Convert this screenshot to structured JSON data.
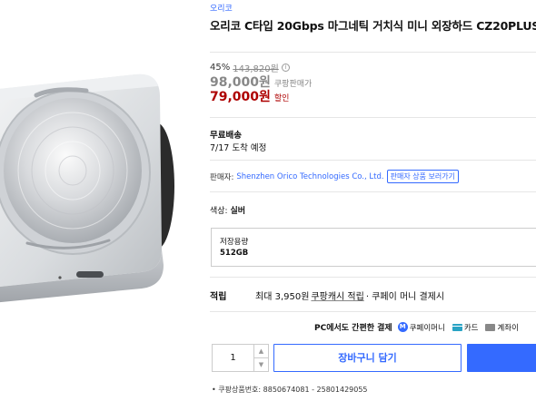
{
  "product": {
    "brand": "오리코",
    "title": "오리코 C타입 20Gbps 마그네틱 거치식 미니 외장하드 CZ20PLUS"
  },
  "pricing": {
    "discount_rate": "45%",
    "original_price": "143,820원",
    "info_icon": "info-icon",
    "coupang_price": "98,000원",
    "coupang_price_label": "쿠팡판매가",
    "sale_price": "79,000원",
    "sale_price_label": "할인",
    "sale_color": "#ae0000"
  },
  "shipping": {
    "title": "무료배송",
    "date": "7/17 도착 예정"
  },
  "seller": {
    "label": "판매자:",
    "name": "Shenzhen Orico Technologies Co., Ltd.",
    "link": "판매자 상품 보러가기"
  },
  "options": {
    "color_label": "색상:",
    "color_value": "실버",
    "storage_label": "저장용량",
    "storage_value": "512GB"
  },
  "reward": {
    "label": "적립",
    "prefix": "최대 3,950원",
    "link": "쿠팡캐시 적립",
    "suffix": "· 쿠페이 머니 결제시"
  },
  "payment": {
    "title": "PC에서도 간편한 결제",
    "methods": [
      {
        "icon": "coupay-icon",
        "label": "쿠페이머니"
      },
      {
        "icon": "card-icon",
        "label": "카드"
      },
      {
        "icon": "bank-icon",
        "label": "계좌이"
      }
    ]
  },
  "purchase": {
    "quantity": "1",
    "cart_label": "장바구니 담기",
    "accent": "#346aff"
  },
  "product_code": "• 쿠팡상품번호: 8850674081 - 25801429055"
}
